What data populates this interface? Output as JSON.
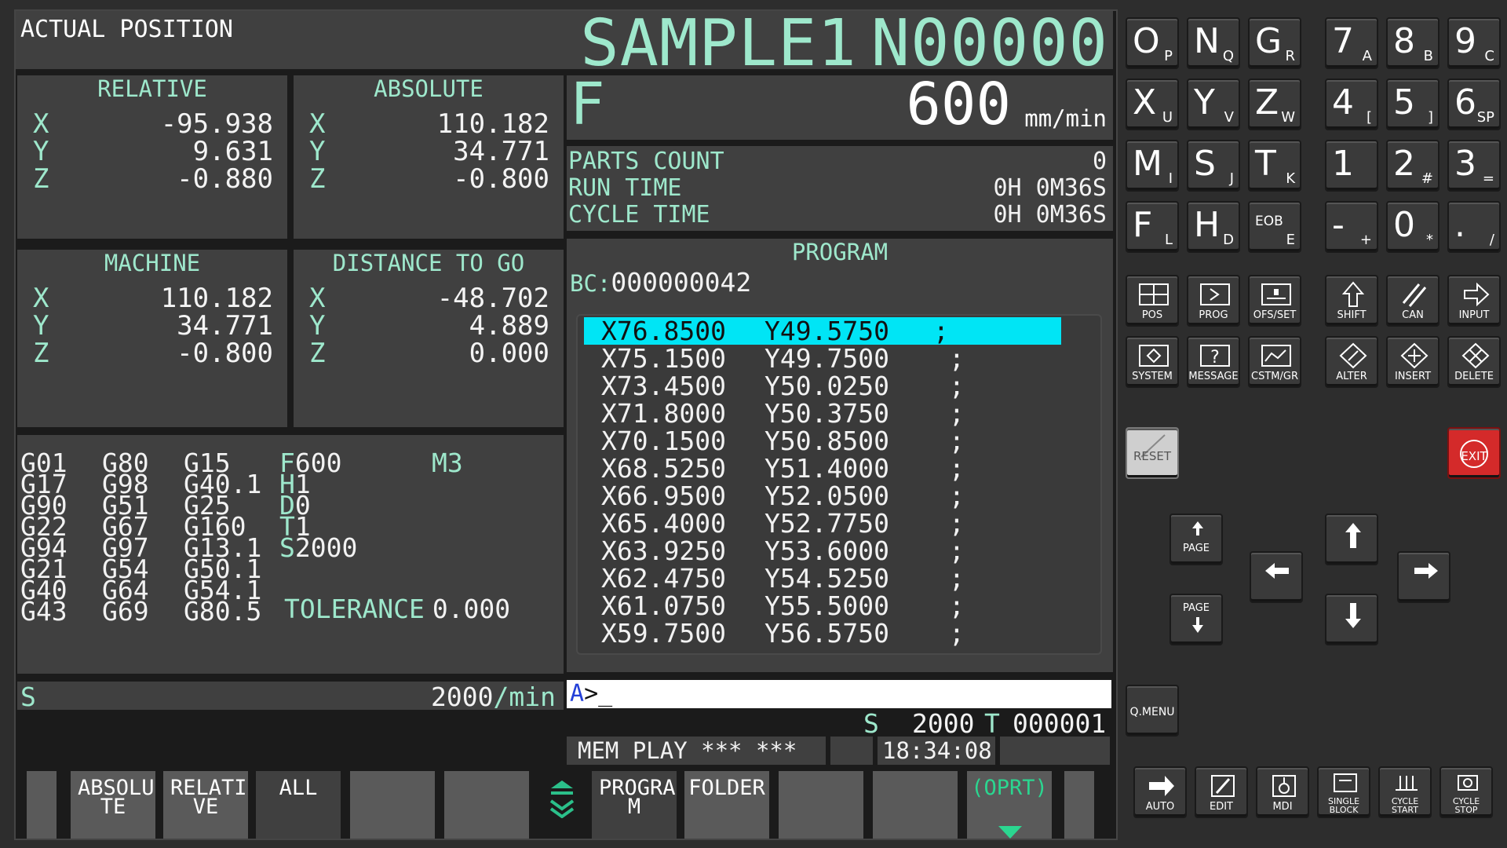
{
  "header": {
    "label": "ACTUAL POSITION",
    "program": "SAMPLE1",
    "sequence": "N00000"
  },
  "relative": {
    "title": "RELATIVE",
    "axes": [
      {
        "axis": "X",
        "value": "-95.938"
      },
      {
        "axis": "Y",
        "value": "9.631"
      },
      {
        "axis": "Z",
        "value": "-0.880"
      }
    ]
  },
  "absolute": {
    "title": "ABSOLUTE",
    "axes": [
      {
        "axis": "X",
        "value": "110.182"
      },
      {
        "axis": "Y",
        "value": "34.771"
      },
      {
        "axis": "Z",
        "value": "-0.800"
      }
    ]
  },
  "machine": {
    "title": "MACHINE",
    "axes": [
      {
        "axis": "X",
        "value": "110.182"
      },
      {
        "axis": "Y",
        "value": "34.771"
      },
      {
        "axis": "Z",
        "value": "-0.800"
      }
    ]
  },
  "distance": {
    "title": "DISTANCE TO GO",
    "axes": [
      {
        "axis": "X",
        "value": "-48.702"
      },
      {
        "axis": "Y",
        "value": "4.889"
      },
      {
        "axis": "Z",
        "value": "0.000"
      }
    ]
  },
  "feed": {
    "letter": "F",
    "value": "600",
    "unit": "mm/min"
  },
  "counts": {
    "parts_label": "PARTS COUNT",
    "parts_value": "0",
    "run_label": "RUN TIME",
    "run_value": "0H 0M36S",
    "cycle_label": "CYCLE TIME",
    "cycle_value": "0H 0M36S"
  },
  "program_panel": {
    "title": "PROGRAM",
    "bc_label": "BC:",
    "bc_value": "000000042",
    "lines": [
      {
        "x": "X76.8500",
        "y": "Y49.5750",
        "end": ";"
      },
      {
        "x": "X75.1500",
        "y": "Y49.7500",
        "end": ";"
      },
      {
        "x": "X73.4500",
        "y": "Y50.0250",
        "end": ";"
      },
      {
        "x": "X71.8000",
        "y": "Y50.3750",
        "end": ";"
      },
      {
        "x": "X70.1500",
        "y": "Y50.8500",
        "end": ";"
      },
      {
        "x": "X68.5250",
        "y": "Y51.4000",
        "end": ";"
      },
      {
        "x": "X66.9500",
        "y": "Y52.0500",
        "end": ";"
      },
      {
        "x": "X65.4000",
        "y": "Y52.7750",
        "end": ";"
      },
      {
        "x": "X63.9250",
        "y": "Y53.6000",
        "end": ";"
      },
      {
        "x": "X62.4750",
        "y": "Y54.5250",
        "end": ";"
      },
      {
        "x": "X61.0750",
        "y": "Y55.5000",
        "end": ";"
      },
      {
        "x": "X59.7500",
        "y": "Y56.5750",
        "end": ";"
      }
    ]
  },
  "modal": {
    "col1": [
      "G01",
      "G17",
      "G90",
      "G22",
      "G94",
      "G21",
      "G40",
      "G43"
    ],
    "col2": [
      "G80",
      "G98",
      "G51",
      "G67",
      "G97",
      "G54",
      "G64",
      "G69"
    ],
    "col3": [
      "G15",
      "G40.1",
      "G25",
      "G160",
      "G13.1",
      "G50.1",
      "G54.1",
      "G80.5"
    ],
    "f_letter": "F",
    "f_value": "600",
    "h_letter": "H",
    "h_value": "1",
    "d_letter": "D",
    "d_value": "0",
    "t_letter": "T",
    "t_value": "1",
    "s_letter": "S",
    "s_value": "2000",
    "m_value": "M3",
    "tolerance_label": "TOLERANCE",
    "tolerance_value": "0.000"
  },
  "spindle": {
    "letter": "S",
    "value": "2000",
    "unit": "/min"
  },
  "input": {
    "prompt_a": "A",
    "prompt": ">_"
  },
  "status": {
    "s_letter": "S",
    "s_value": "2000",
    "t_letter": "T",
    "t_value": "000001",
    "mode": "MEM PLAY *** ***",
    "time": "18:34:08"
  },
  "softkeys": [
    "ABSOLU TE",
    "RELATI VE",
    "ALL",
    "PROGRA M",
    "FOLDER",
    "(OPRT)"
  ],
  "keypad": {
    "address": [
      {
        "m": "O",
        "s": "P"
      },
      {
        "m": "N",
        "s": "Q"
      },
      {
        "m": "G",
        "s": "R"
      },
      {
        "m": "X",
        "s": "U"
      },
      {
        "m": "Y",
        "s": "V"
      },
      {
        "m": "Z",
        "s": "W"
      },
      {
        "m": "M",
        "s": "I"
      },
      {
        "m": "S",
        "s": "J"
      },
      {
        "m": "T",
        "s": "K"
      },
      {
        "m": "F",
        "s": "L"
      },
      {
        "m": "H",
        "s": "D"
      },
      {
        "m": "EOB",
        "s": "E"
      }
    ],
    "numeric": [
      {
        "m": "7",
        "s": "A"
      },
      {
        "m": "8",
        "s": "B"
      },
      {
        "m": "9",
        "s": "C"
      },
      {
        "m": "4",
        "s": "["
      },
      {
        "m": "5",
        "s": "]"
      },
      {
        "m": "6",
        "s": "SP"
      },
      {
        "m": "1",
        "s": ""
      },
      {
        "m": "2",
        "s": "#"
      },
      {
        "m": "3",
        "s": "="
      },
      {
        "m": "-",
        "s": "+"
      },
      {
        "m": "0",
        "s": "*"
      },
      {
        "m": ".",
        "s": "/"
      }
    ],
    "functions": [
      "POS",
      "PROG",
      "OFS/SET",
      "SHIFT",
      "CAN",
      "INPUT",
      "SYSTEM",
      "MESSAGE",
      "CSTM/GR",
      "ALTER",
      "INSERT",
      "DELETE"
    ],
    "reset": "RESET",
    "exit": "EXIT",
    "page_up": "PAGE",
    "page_down": "PAGE",
    "qmenu": "Q.MENU",
    "modes": [
      "AUTO",
      "EDIT",
      "MDI",
      "SINGLE BLOCK",
      "CYCLE START",
      "CYCLE STOP"
    ]
  },
  "colors": {
    "accent": "#9ee8cc",
    "highlight": "#00e5f5",
    "exit": "#d42a2a",
    "panel": "#404040"
  }
}
